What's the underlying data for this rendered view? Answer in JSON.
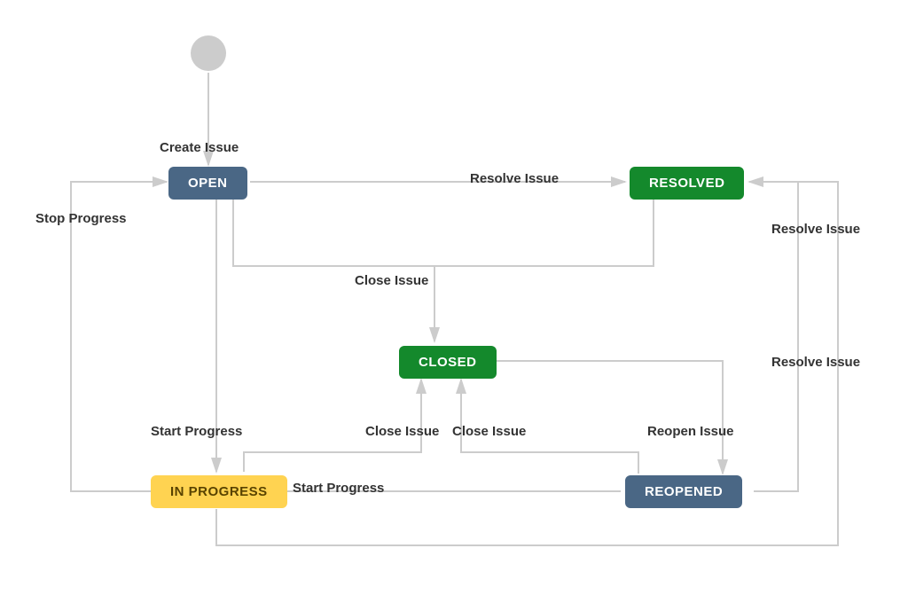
{
  "states": {
    "open": "OPEN",
    "resolved": "RESOLVED",
    "closed": "CLOSED",
    "in_progress": "IN PROGRESS",
    "reopened": "REOPENED"
  },
  "transitions": {
    "create_issue": "Create Issue",
    "resolve_issue": "Resolve Issue",
    "close_issue": "Close Issue",
    "start_progress": "Start Progress",
    "stop_progress": "Stop Progress",
    "reopen_issue": "Reopen Issue"
  },
  "colors": {
    "edge": "#cccccc",
    "text": "#333333"
  },
  "workflow": {
    "start_to": "open",
    "edges": [
      {
        "from": "start",
        "to": "open",
        "label": "Create Issue"
      },
      {
        "from": "open",
        "to": "resolved",
        "label": "Resolve Issue"
      },
      {
        "from": "open",
        "to": "closed",
        "label": "Close Issue"
      },
      {
        "from": "open",
        "to": "in_progress",
        "label": "Start Progress"
      },
      {
        "from": "in_progress",
        "to": "open",
        "label": "Stop Progress"
      },
      {
        "from": "in_progress",
        "to": "closed",
        "label": "Close Issue"
      },
      {
        "from": "in_progress",
        "to": "resolved",
        "label": "Resolve Issue"
      },
      {
        "from": "resolved",
        "to": "closed",
        "label": "Close Issue"
      },
      {
        "from": "reopened",
        "to": "in_progress",
        "label": "Start Progress"
      },
      {
        "from": "reopened",
        "to": "closed",
        "label": "Close Issue"
      },
      {
        "from": "reopened",
        "to": "resolved",
        "label": "Resolve Issue"
      },
      {
        "from": "closed",
        "to": "reopened",
        "label": "Reopen Issue"
      }
    ]
  }
}
